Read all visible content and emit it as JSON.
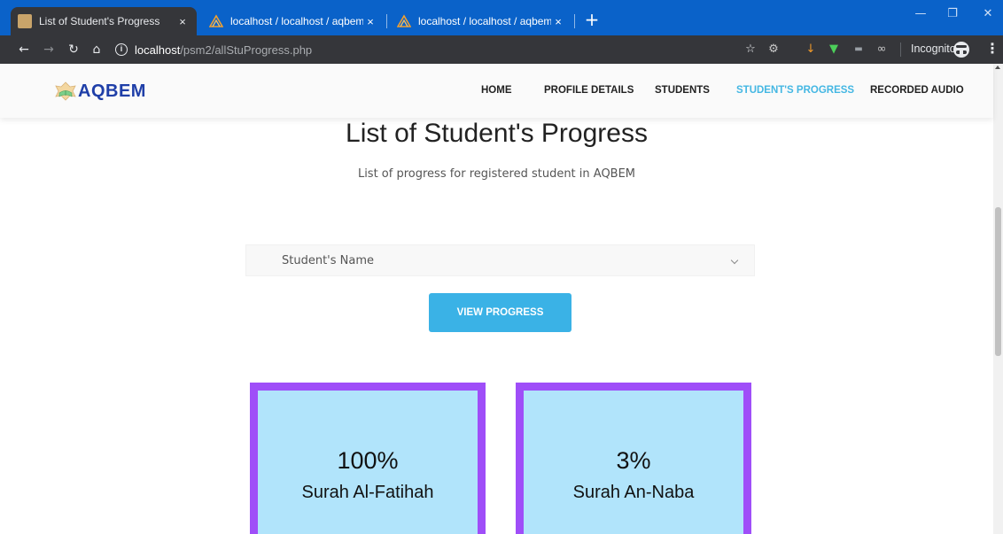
{
  "browser": {
    "tabs": [
      {
        "title": "List of Student's Progress",
        "active": true
      },
      {
        "title": "localhost / localhost / aqbem / to",
        "active": false
      },
      {
        "title": "localhost / localhost / aqbem / st",
        "active": false
      }
    ],
    "new_tab": "+",
    "close_glyph": "×",
    "url_host": "localhost",
    "url_path": "/psm2/allStuProgress.php",
    "incognito_label": "Incognito",
    "colors": {
      "tabbar": "#0a62c9",
      "toolbar": "#35363a"
    }
  },
  "site": {
    "logo_text": "AQBEM",
    "nav": [
      {
        "label": "HOME",
        "active": false
      },
      {
        "label": "PROFILE DETAILS",
        "active": false
      },
      {
        "label": "STUDENTS",
        "active": false
      },
      {
        "label": "STUDENT'S PROGRESS",
        "active": true
      },
      {
        "label": "RECORDED AUDIO",
        "active": false
      }
    ],
    "colors": {
      "accent": "#44b7e3",
      "button": "#3ab2e6",
      "card_bg": "#b1e4fb",
      "card_border": "#9f4ef8"
    }
  },
  "main": {
    "title": "List of Student's Progress",
    "subtitle": "List of progress for registered student in AQBEM",
    "select": {
      "selected": "Student's Name"
    },
    "view_button": "VIEW PROGRESS",
    "cards": [
      {
        "percent": "100%",
        "surah": "Surah Al-Fatihah"
      },
      {
        "percent": "3%",
        "surah": "Surah An-Naba"
      }
    ]
  }
}
